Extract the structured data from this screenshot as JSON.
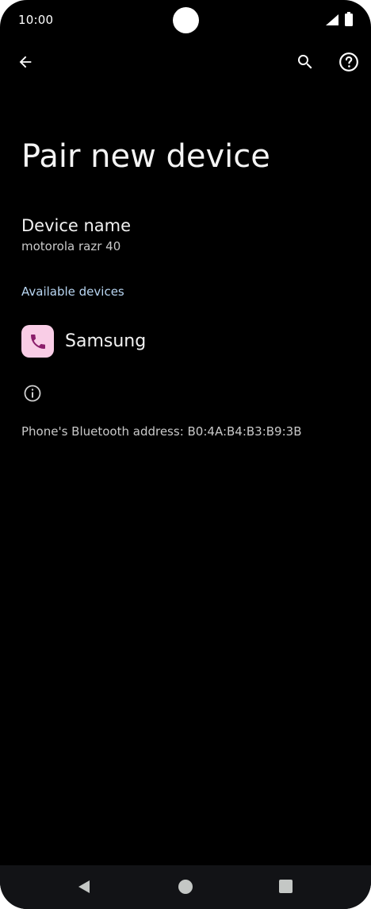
{
  "status_bar": {
    "time": "10:00",
    "icons": [
      "signal-icon",
      "battery-icon"
    ]
  },
  "app_bar": {
    "back_icon": "arrow-back-icon",
    "search_icon": "search-icon",
    "help_icon": "help-icon"
  },
  "page": {
    "title": "Pair new device"
  },
  "device_name": {
    "title": "Device name",
    "value": "motorola razr 40"
  },
  "available_devices": {
    "header": "Available devices",
    "items": [
      {
        "label": "Samsung",
        "icon": "phone-icon",
        "icon_bg": "#f9cde6",
        "icon_color": "#8b1e6b"
      }
    ]
  },
  "footer_info": {
    "icon": "info-icon",
    "bluetooth_address": "Phone's Bluetooth address: B0:4A:B4:B3:B9:3B"
  },
  "nav_bar": {
    "buttons": [
      "nav-back-icon",
      "nav-home-icon",
      "nav-recents-icon"
    ]
  },
  "colors": {
    "background": "#000000",
    "accent_header": "#b9d6f2",
    "nav_bar": "#121316"
  }
}
